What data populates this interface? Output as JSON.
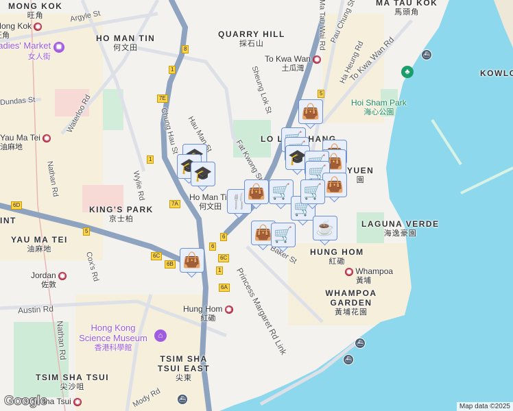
{
  "districts": {
    "mong_kok": {
      "en": "MONG KOK",
      "zh": "旺角"
    },
    "ho_man_tin": {
      "en": "HO MAN TIN",
      "zh": "何文田"
    },
    "quarry_hill": {
      "en": "QUARRY HILL",
      "zh": "採石山"
    },
    "ma_tau_kok": {
      "en": "MA TAU KOK",
      "zh": "馬頭角"
    },
    "kowloon": {
      "en": "KOWLO"
    },
    "lo_lung_hang": {
      "en": "LO LUNG HANG"
    },
    "yuen": {
      "en": "YUEN",
      "zh": "園"
    },
    "kings_park": {
      "en": "KING'S PARK",
      "zh": "京士柏"
    },
    "yau_ma_tei": {
      "en": "YAU MA TEI",
      "zh": "油麻地"
    },
    "laguna_verde": {
      "en": "LAGUNA VERDE",
      "zh": "海逸豪園"
    },
    "hung_hom": {
      "en": "HUNG HOM",
      "zh": "紅磡"
    },
    "whampoa_garden": {
      "en": "WHAMPOA GARDEN",
      "zh": "黃埔花園"
    },
    "tst_east": {
      "en": "TSIM SHA TSUI EAST",
      "zh": "尖東"
    },
    "tst": {
      "en": "TSIM SHA TSUI",
      "zh": "尖沙咀"
    },
    "int": {
      "en": "INT"
    }
  },
  "stations": {
    "mong_kok": {
      "en": "Mong Kok",
      "zh": "旺角"
    },
    "to_kwa_wan": {
      "en": "To Kwa Wan",
      "zh": "土瓜灣"
    },
    "yau_ma_tei": {
      "en": "Yau Ma Tei",
      "zh": "油麻地"
    },
    "jordan": {
      "en": "Jordan",
      "zh": "佐敦"
    },
    "hung_hom": {
      "en": "Hung Hom",
      "zh": "紅磡"
    },
    "whampoa": {
      "en": "Whampoa",
      "zh": "黃埔"
    },
    "ho_man_tin": {
      "en": "Ho Man Tin",
      "zh": "何文田"
    },
    "tst": {
      "en": "Tsim Sha Tsui",
      "zh": "尖沙咀"
    }
  },
  "pois": {
    "ladies_market": {
      "en": "Ladies' Market",
      "zh": "女人街"
    },
    "hoi_sham_park": {
      "en": "Hoi Sham Park",
      "zh": "海心公園"
    },
    "science_museum": {
      "en": "Hong Kong Science Museum",
      "zh": "香港科學館"
    }
  },
  "streets": [
    "Argyle St",
    "Dundas St",
    "Waterloo Rd",
    "Nathan Rd",
    "Wylie Rd",
    "Chung Hau St",
    "Hau Man St",
    "Fat Kwong St",
    "Sheung Lok St",
    "Ma Tau Wai Rd",
    "Pau Chung St",
    "Ha Heung Rd",
    "To Kwa Wan Rd",
    "Cox's Rd",
    "Austin Rd",
    "Princess Margaret Rd Link",
    "Baker St",
    "Mody Rd"
  ],
  "route_shields": [
    "8",
    "1",
    "7E",
    "1",
    "7A",
    "6D",
    "5",
    "6C",
    "6B",
    "6",
    "6",
    "6C",
    "1",
    "6A",
    "5"
  ],
  "markers": [
    "shopping-bag",
    "shopping-cart",
    "shopping-cart",
    "graduation-cap",
    "shopping-bag",
    "shopping-bag",
    "shopping-cart",
    "shopping-cart",
    "shopping-bag",
    "graduation-cap",
    "graduation-cap",
    "graduation-cap",
    "cutlery",
    "shopping-bag",
    "shopping-cart",
    "shopping-cart",
    "shopping-cart",
    "shopping-bag",
    "shopping-cart",
    "coffee-cup",
    "shopping-bag"
  ],
  "attribution": "Map data ©2025",
  "logo": "Google",
  "colors": {
    "water": "#8dd8ec",
    "land": "#f3f2ef",
    "highway": "#8ea3bf",
    "marker_fill": "#e8effb",
    "marker_icon": "#0e3a5c"
  }
}
